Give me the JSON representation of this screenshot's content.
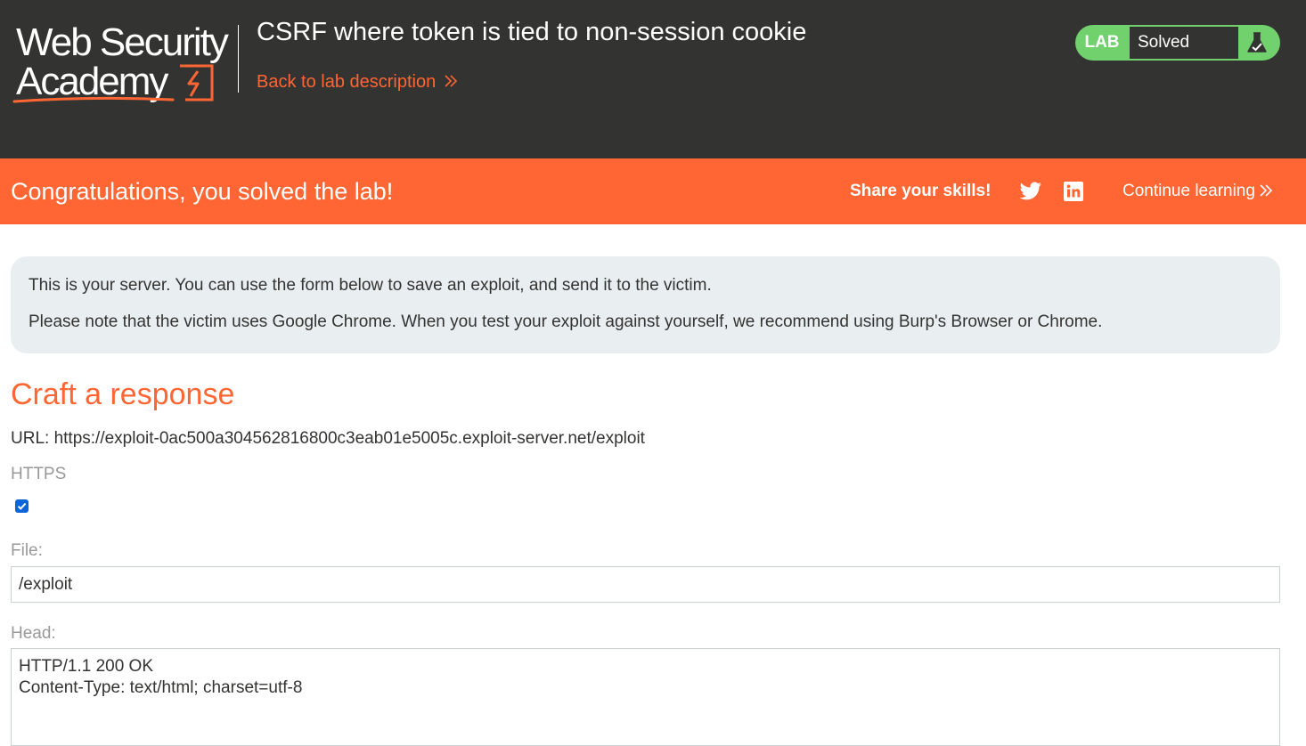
{
  "header": {
    "logo": {
      "line1": "Web Security",
      "line2": "Academy"
    },
    "lab_title": "CSRF where token is tied to non-session cookie",
    "back_link": "Back to lab description",
    "status": {
      "tag": "LAB",
      "text": "Solved",
      "icon": "flask-solved-icon"
    }
  },
  "banner": {
    "message": "Congratulations, you solved the lab!",
    "share_label": "Share your skills!",
    "share_icons": [
      "twitter-icon",
      "linkedin-icon"
    ],
    "continue_link": "Continue learning"
  },
  "info": {
    "line1": "This is your server. You can use the form below to save an exploit, and send it to the victim.",
    "line2": "Please note that the victim uses Google Chrome. When you test your exploit against yourself, we recommend using Burp's Browser or Chrome."
  },
  "form": {
    "title": "Craft a response",
    "url_line": "URL: https://exploit-0ac500a304562816800c3eab01e5005c.exploit-server.net/exploit",
    "https_label": "HTTPS",
    "https_checked": true,
    "file_label": "File:",
    "file_value": "/exploit",
    "head_label": "Head:",
    "head_value": "HTTP/1.1 200 OK\nContent-Type: text/html; charset=utf-8"
  },
  "colors": {
    "header_bg": "#333332",
    "accent_orange": "#ff6633",
    "solved_green": "#70d16d",
    "info_bg": "#e9eff1",
    "checkbox_blue": "#0a66d8"
  }
}
